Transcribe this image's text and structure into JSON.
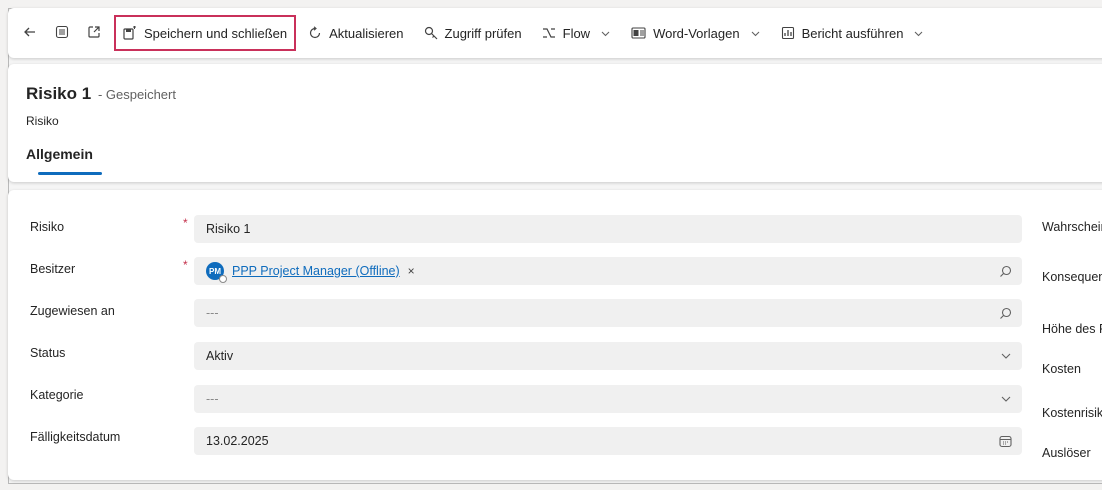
{
  "toolbar": {
    "back_icon": "arrow-left-icon",
    "record_set_icon": "list-icon",
    "popout_icon": "open-new-window-icon",
    "save_close_label": "Speichern und schließen",
    "refresh_label": "Aktualisieren",
    "check_access_label": "Zugriff prüfen",
    "flow_label": "Flow",
    "word_templates_label": "Word-Vorlagen",
    "run_report_label": "Bericht ausführen",
    "highlight_color": "#c9305a"
  },
  "header": {
    "title": "Risiko 1",
    "save_state": "- Gespeichert",
    "entity": "Risiko",
    "tabs": [
      {
        "label": "Allgemein",
        "active": true
      }
    ],
    "accent_color": "#0f6cbd"
  },
  "form": {
    "left_fields": [
      {
        "label": "Risiko",
        "required": true,
        "value": "Risiko 1"
      },
      {
        "label": "Besitzer",
        "required": true,
        "lookup_initials": "PM",
        "lookup_value": "PPP Project Manager (Offline)",
        "remove": "×"
      },
      {
        "label": "Zugewiesen an",
        "required": false,
        "value": "---"
      },
      {
        "label": "Status",
        "required": false,
        "value": "Aktiv"
      },
      {
        "label": "Kategorie",
        "required": false,
        "value": "---"
      },
      {
        "label": "Fälligkeitsdatum",
        "required": false,
        "value": "13.02.2025"
      }
    ],
    "right_labels": [
      "Wahrschein",
      "Konsequen",
      "Höhe des F",
      "Kosten",
      "Kostenrisik",
      "Auslöser"
    ],
    "required_marker": "*"
  }
}
